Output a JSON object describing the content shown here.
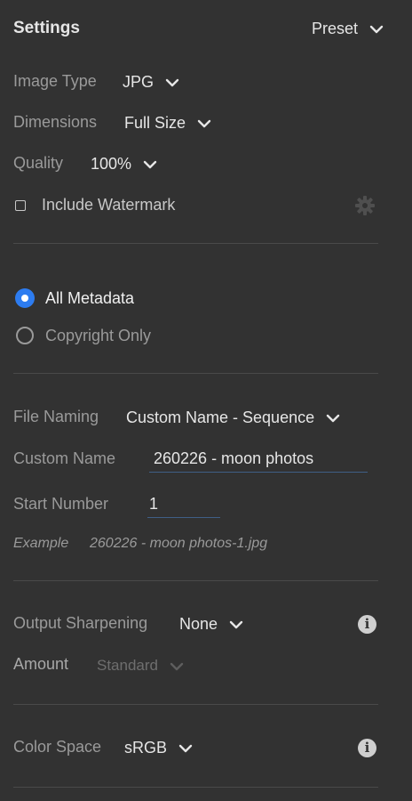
{
  "header": {
    "title": "Settings",
    "preset_label": "Preset"
  },
  "image_type": {
    "label": "Image Type",
    "value": "JPG"
  },
  "dimensions": {
    "label": "Dimensions",
    "value": "Full Size"
  },
  "quality": {
    "label": "Quality",
    "value": "100%"
  },
  "watermark": {
    "label": "Include Watermark",
    "checked": false
  },
  "metadata": {
    "options": [
      {
        "label": "All Metadata",
        "selected": true
      },
      {
        "label": "Copyright Only",
        "selected": false
      }
    ]
  },
  "file_naming": {
    "label": "File Naming",
    "value": "Custom Name - Sequence"
  },
  "custom_name": {
    "label": "Custom Name",
    "value": "260226 - moon photos"
  },
  "start_number": {
    "label": "Start Number",
    "value": "1"
  },
  "example": {
    "label": "Example",
    "value": "260226 - moon photos-1.jpg"
  },
  "output_sharpening": {
    "label": "Output Sharpening",
    "value": "None"
  },
  "amount": {
    "label": "Amount",
    "value": "Standard"
  },
  "color_space": {
    "label": "Color Space",
    "value": "sRGB"
  },
  "icons": {
    "chevron": "chevron-down-icon",
    "gear": "gear-icon",
    "info": "info-icon"
  },
  "colors": {
    "background": "#323232",
    "accent": "#2d7cf0",
    "text_primary": "#e6e6e6",
    "text_secondary": "#9a9a9a",
    "text_disabled": "#6e6e6e"
  }
}
